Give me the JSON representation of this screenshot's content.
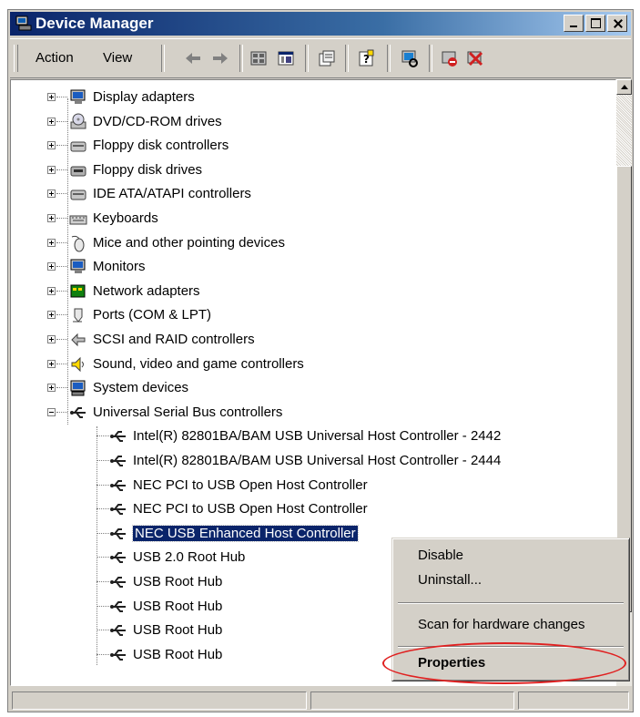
{
  "window": {
    "title": "Device Manager"
  },
  "toolbar": {
    "menus": [
      {
        "label": "Action"
      },
      {
        "label": "View"
      }
    ],
    "tools": [
      {
        "icon": "back-arrow-icon"
      },
      {
        "icon": "forward-arrow-icon"
      },
      {
        "icon": "up-folder-icon"
      },
      {
        "icon": "show-hide-tree-icon"
      },
      {
        "icon": "properties-icon"
      },
      {
        "icon": "help-icon"
      },
      {
        "icon": "scan-hardware-icon"
      },
      {
        "icon": "disable-device-icon"
      },
      {
        "icon": "uninstall-device-icon"
      }
    ]
  },
  "tree": {
    "categories": [
      {
        "label": "Display adapters",
        "icon": "display-icon",
        "expanded": false
      },
      {
        "label": "DVD/CD-ROM drives",
        "icon": "dvd-icon",
        "expanded": false
      },
      {
        "label": "Floppy disk controllers",
        "icon": "floppy-controller-icon",
        "expanded": false
      },
      {
        "label": "Floppy disk drives",
        "icon": "floppy-drive-icon",
        "expanded": false
      },
      {
        "label": "IDE ATA/ATAPI controllers",
        "icon": "ide-icon",
        "expanded": false
      },
      {
        "label": "Keyboards",
        "icon": "keyboard-icon",
        "expanded": false
      },
      {
        "label": "Mice and other pointing devices",
        "icon": "mouse-icon",
        "expanded": false
      },
      {
        "label": "Monitors",
        "icon": "monitor-icon",
        "expanded": false
      },
      {
        "label": "Network adapters",
        "icon": "network-icon",
        "expanded": false
      },
      {
        "label": "Ports (COM & LPT)",
        "icon": "port-icon",
        "expanded": false
      },
      {
        "label": "SCSI and RAID controllers",
        "icon": "scsi-icon",
        "expanded": false
      },
      {
        "label": "Sound, video and game controllers",
        "icon": "sound-icon",
        "expanded": false
      },
      {
        "label": "System devices",
        "icon": "system-icon",
        "expanded": false
      },
      {
        "label": "Universal Serial Bus controllers",
        "icon": "usb-icon",
        "expanded": true
      }
    ],
    "usb_children": [
      {
        "label": "Intel(R) 82801BA/BAM USB Universal Host Controller - 2442",
        "selected": false
      },
      {
        "label": "Intel(R) 82801BA/BAM USB Universal Host Controller - 2444",
        "selected": false
      },
      {
        "label": "NEC PCI to USB Open Host Controller",
        "selected": false
      },
      {
        "label": "NEC PCI to USB Open Host Controller",
        "selected": false
      },
      {
        "label": "NEC USB Enhanced Host Controller",
        "selected": true
      },
      {
        "label": "USB 2.0 Root Hub",
        "selected": false
      },
      {
        "label": "USB Root Hub",
        "selected": false
      },
      {
        "label": "USB Root Hub",
        "selected": false
      },
      {
        "label": "USB Root Hub",
        "selected": false
      },
      {
        "label": "USB Root Hub",
        "selected": false
      }
    ]
  },
  "context_menu": {
    "disable": "Disable",
    "uninstall": "Uninstall...",
    "scan": "Scan for hardware changes",
    "properties": "Properties"
  },
  "colors": {
    "selection": "#0a246a",
    "highlight_ellipse": "#e02020",
    "face": "#d4d0c8"
  }
}
